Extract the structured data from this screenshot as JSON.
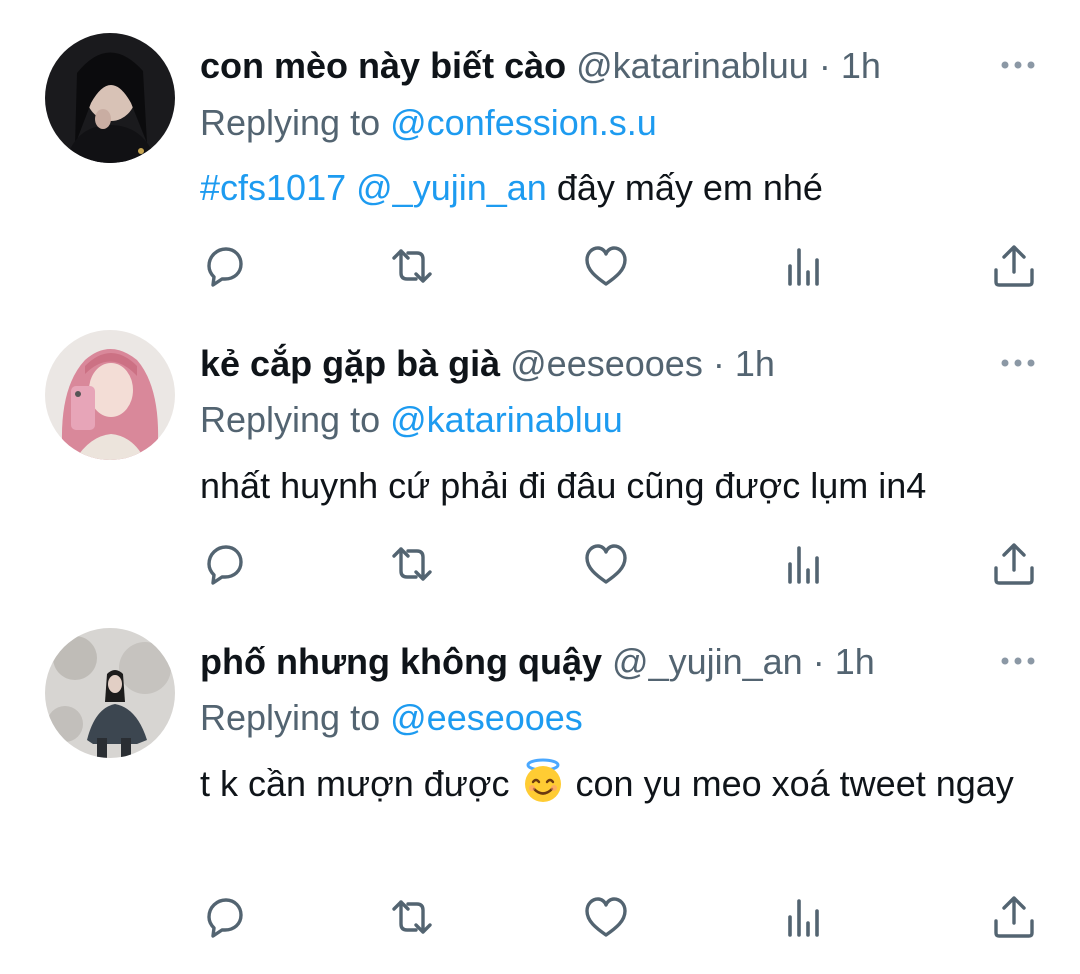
{
  "tweets": [
    {
      "name": "con mèo này biết cào",
      "handle": "@katarinabluu",
      "dot": "·",
      "time": "1h",
      "replying_prefix": "Replying to",
      "replying_to": "@confession.s.u",
      "body": {
        "hashtag": "#cfs1017",
        "mention": "@_yujin_an",
        "text": "đây mấy em nhé"
      },
      "avatar_icon": "avatar-photo-dark-hair"
    },
    {
      "name": "kẻ cắp gặp bà già",
      "handle": "@eeseooes",
      "dot": "·",
      "time": "1h",
      "replying_prefix": "Replying to",
      "replying_to": "@katarinabluu",
      "body": {
        "text": "nhất huynh cứ phải đi đâu cũng được lụm in4"
      },
      "avatar_icon": "avatar-photo-pink-hair"
    },
    {
      "name": "phố nhưng không quậy",
      "handle": "@_yujin_an",
      "dot": "·",
      "time": "1h",
      "replying_prefix": "Replying to",
      "replying_to": "@eeseooes",
      "body": {
        "text_before": "t k cần mượn được",
        "emoji": "smiling-face-with-halo-emoji",
        "text_after": "con yu meo xoá tweet ngay"
      },
      "avatar_icon": "avatar-photo-outdoor"
    }
  ],
  "actions": [
    "reply-icon",
    "retweet-icon",
    "like-icon",
    "views-icon",
    "share-icon"
  ],
  "colors": {
    "text": "#0f1419",
    "secondary": "#536471",
    "link": "#1d9bf0",
    "icon": "#536471"
  }
}
